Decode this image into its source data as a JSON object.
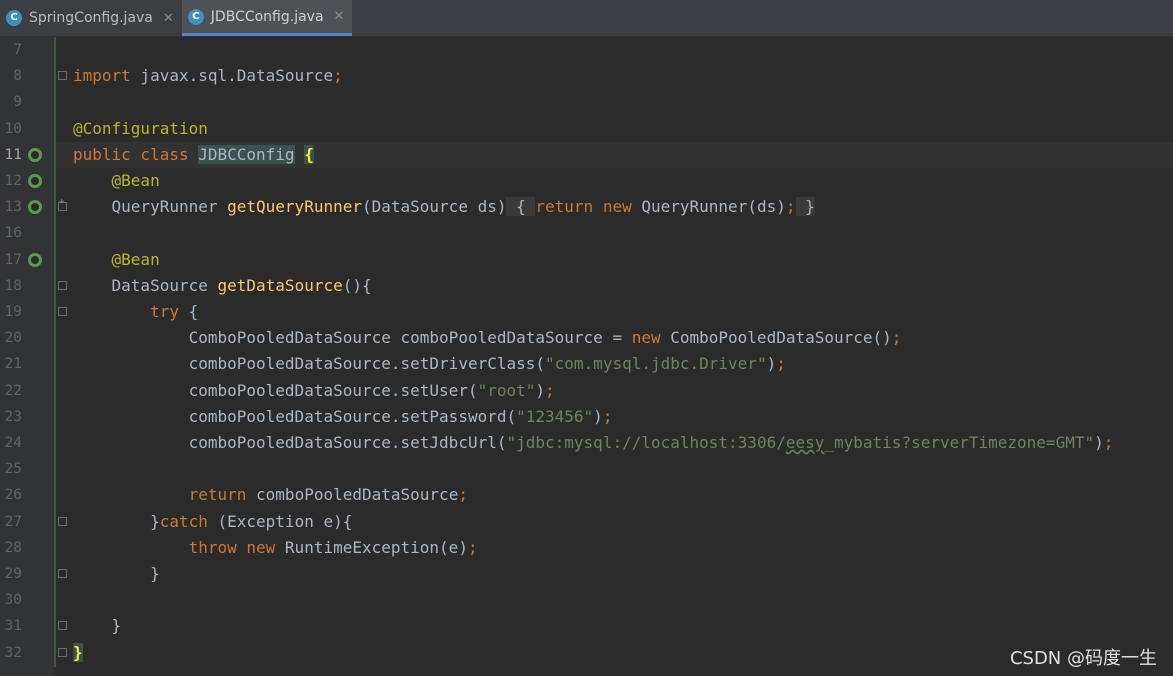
{
  "tabs": [
    {
      "icon": "class-c-icon",
      "badge": "C",
      "label": "SpringConfig.java",
      "active": false
    },
    {
      "icon": "class-c-icon",
      "badge": "C",
      "label": "JDBCConfig.java",
      "active": true
    }
  ],
  "tab_close_glyph": "✕",
  "lines": [
    {
      "num": "7",
      "tokens": []
    },
    {
      "num": "8",
      "tokens": [
        {
          "t": "import",
          "c": "kw"
        },
        {
          "t": " javax.sql.DataSource",
          "c": ""
        },
        {
          "t": ";",
          "c": "kw"
        }
      ]
    },
    {
      "num": "9",
      "tokens": []
    },
    {
      "num": "10",
      "tokens": [
        {
          "t": "@Configuration",
          "c": "ann"
        }
      ]
    },
    {
      "num": "11",
      "tokens": [
        {
          "t": "public class ",
          "c": "kw"
        },
        {
          "t": "JDBCConfig",
          "c": "sel"
        },
        {
          "t": " ",
          "c": ""
        },
        {
          "t": "{",
          "c": "brace-hl"
        }
      ]
    },
    {
      "num": "12",
      "tokens": [
        {
          "t": "    ",
          "c": ""
        },
        {
          "t": "@Bean",
          "c": "ann"
        }
      ]
    },
    {
      "num": "13",
      "tokens": [
        {
          "t": "    QueryRunner ",
          "c": ""
        },
        {
          "t": "getQueryRunner",
          "c": "fn"
        },
        {
          "t": "(DataSource ds)",
          "c": ""
        },
        {
          "t": " { ",
          "c": "fold-box"
        },
        {
          "t": "return new ",
          "c": "kw"
        },
        {
          "t": "QueryRunner(ds)",
          "c": ""
        },
        {
          "t": ";",
          "c": "kw"
        },
        {
          "t": " }",
          "c": "fold-box"
        }
      ]
    },
    {
      "num": "16",
      "tokens": []
    },
    {
      "num": "17",
      "tokens": [
        {
          "t": "    ",
          "c": ""
        },
        {
          "t": "@Bean",
          "c": "ann"
        }
      ]
    },
    {
      "num": "18",
      "tokens": [
        {
          "t": "    DataSource ",
          "c": ""
        },
        {
          "t": "getDataSource",
          "c": "fn"
        },
        {
          "t": "(){",
          "c": ""
        }
      ]
    },
    {
      "num": "19",
      "tokens": [
        {
          "t": "        ",
          "c": ""
        },
        {
          "t": "try ",
          "c": "kw"
        },
        {
          "t": "{",
          "c": ""
        }
      ]
    },
    {
      "num": "20",
      "tokens": [
        {
          "t": "            ComboPooledDataSource comboPooledDataSource = ",
          "c": ""
        },
        {
          "t": "new ",
          "c": "kw"
        },
        {
          "t": "ComboPooledDataSource()",
          "c": ""
        },
        {
          "t": ";",
          "c": "kw"
        }
      ]
    },
    {
      "num": "21",
      "tokens": [
        {
          "t": "            comboPooledDataSource.setDriverClass(",
          "c": ""
        },
        {
          "t": "\"com.mysql.jdbc.Driver\"",
          "c": "str"
        },
        {
          "t": ")",
          "c": ""
        },
        {
          "t": ";",
          "c": "kw"
        }
      ]
    },
    {
      "num": "22",
      "tokens": [
        {
          "t": "            comboPooledDataSource.setUser(",
          "c": ""
        },
        {
          "t": "\"root\"",
          "c": "str"
        },
        {
          "t": ")",
          "c": ""
        },
        {
          "t": ";",
          "c": "kw"
        }
      ]
    },
    {
      "num": "23",
      "tokens": [
        {
          "t": "            comboPooledDataSource.setPassword(",
          "c": ""
        },
        {
          "t": "\"123456\"",
          "c": "str"
        },
        {
          "t": ")",
          "c": ""
        },
        {
          "t": ";",
          "c": "kw"
        }
      ]
    },
    {
      "num": "24",
      "tokens": [
        {
          "t": "            comboPooledDataSource.setJdbcUrl(",
          "c": ""
        },
        {
          "t": "\"jdbc:mysql://localhost:3306/",
          "c": "str"
        },
        {
          "t": "eesy",
          "c": "str underline"
        },
        {
          "t": "_mybatis?serverTimezone=GMT\"",
          "c": "str"
        },
        {
          "t": ")",
          "c": ""
        },
        {
          "t": ";",
          "c": "kw"
        }
      ]
    },
    {
      "num": "25",
      "tokens": []
    },
    {
      "num": "26",
      "tokens": [
        {
          "t": "            ",
          "c": ""
        },
        {
          "t": "return ",
          "c": "kw"
        },
        {
          "t": "comboPooledDataSource",
          "c": ""
        },
        {
          "t": ";",
          "c": "kw"
        }
      ]
    },
    {
      "num": "27",
      "tokens": [
        {
          "t": "        }",
          "c": ""
        },
        {
          "t": "catch ",
          "c": "kw"
        },
        {
          "t": "(Exception e){",
          "c": ""
        }
      ]
    },
    {
      "num": "28",
      "tokens": [
        {
          "t": "            ",
          "c": ""
        },
        {
          "t": "throw new ",
          "c": "kw"
        },
        {
          "t": "RuntimeException(e)",
          "c": ""
        },
        {
          "t": ";",
          "c": "kw"
        }
      ]
    },
    {
      "num": "29",
      "tokens": [
        {
          "t": "        }",
          "c": ""
        }
      ]
    },
    {
      "num": "30",
      "tokens": []
    },
    {
      "num": "31",
      "tokens": [
        {
          "t": "    }",
          "c": ""
        }
      ]
    },
    {
      "num": "32",
      "tokens": [
        {
          "t": "}",
          "c": "brace-hl"
        }
      ]
    }
  ],
  "current_line": "11",
  "gutter_icons": {
    "11": "spring-bean-config-icon",
    "12": "spring-bean-icon",
    "13": "spring-bean-icon",
    "17": "spring-bean-icon"
  },
  "folds": {
    "8": "minus",
    "13": "plus",
    "18": "minus",
    "19": "minus",
    "27": "minus",
    "29": "minus",
    "31": "minus",
    "32": "minus"
  },
  "watermark": "CSDN @码度一生"
}
